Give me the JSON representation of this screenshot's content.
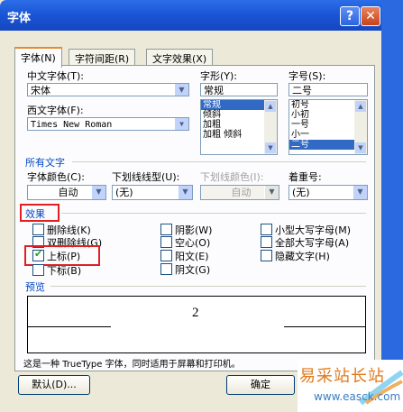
{
  "window": {
    "title": "字体"
  },
  "tabs": [
    "字体(N)",
    "字符间距(R)",
    "文字效果(X)"
  ],
  "labels": {
    "cn_font": "中文字体(T):",
    "west_font": "西文字体(F):",
    "style": "字形(Y):",
    "size": "字号(S):",
    "all_text": "所有文字",
    "font_color": "字体颜色(C):",
    "underline_type": "下划线线型(U):",
    "underline_color": "下划线颜色(I):",
    "emphasis": "着重号:",
    "effects": "效果",
    "preview": "预览"
  },
  "fields": {
    "cn_font": "宋体",
    "west_font": "Times New Roman",
    "style": "常规",
    "size": "二号",
    "font_color": "自动",
    "underline_type": "(无)",
    "underline_color": "自动",
    "emphasis": "(无)"
  },
  "style_list": [
    "常规",
    "倾斜",
    "加粗",
    "加粗 倾斜"
  ],
  "size_list": [
    "初号",
    "小初",
    "一号",
    "小一",
    "二号"
  ],
  "effects": [
    {
      "label": "删除线(K)",
      "checked": false
    },
    {
      "label": "双删除线(G)",
      "checked": false
    },
    {
      "label": "上标(P)",
      "checked": true
    },
    {
      "label": "下标(B)",
      "checked": false
    },
    {
      "label": "阴影(W)",
      "checked": false
    },
    {
      "label": "空心(O)",
      "checked": false
    },
    {
      "label": "阳文(E)",
      "checked": false
    },
    {
      "label": "阴文(G)",
      "checked": false
    },
    {
      "label": "小型大写字母(M)",
      "checked": false
    },
    {
      "label": "全部大写字母(A)",
      "checked": false
    },
    {
      "label": "隐藏文字(H)",
      "checked": false
    }
  ],
  "preview_text": "2",
  "info": "这是一种 TrueType 字体，同时适用于屏幕和打印机。",
  "buttons": {
    "default": "默认(D)...",
    "ok": "确定"
  },
  "watermark": {
    "line1": "易采站长站",
    "line2": "www.easck.com"
  }
}
